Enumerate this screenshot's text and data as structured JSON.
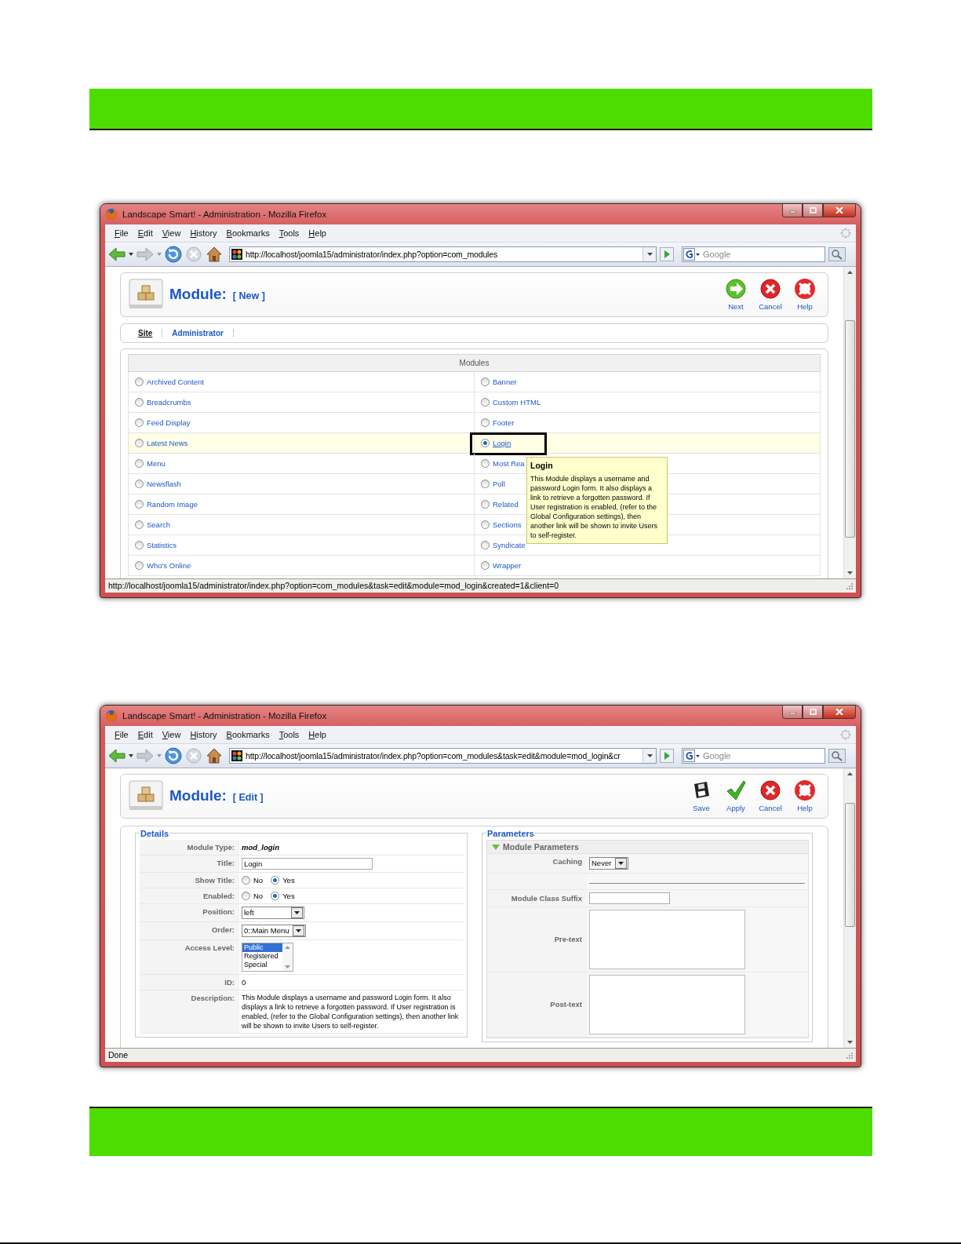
{
  "windows": [
    {
      "kind": "module_list",
      "title": "Landscape Smart! - Administration - Mozilla Firefox",
      "menu": [
        "File",
        "Edit",
        "View",
        "History",
        "Bookmarks",
        "Tools",
        "Help"
      ],
      "url": "http://localhost/joomla15/administrator/index.php?option=com_modules",
      "search": {
        "placeholder": "Google"
      },
      "page_title": "Module:",
      "page_subtitle": "[ New ]",
      "toolbar": [
        {
          "label": "Next",
          "kind": "next"
        },
        {
          "label": "Cancel",
          "kind": "cancel"
        },
        {
          "label": "Help",
          "kind": "help"
        }
      ],
      "submenu": [
        {
          "label": "Site",
          "selected": true
        },
        {
          "label": "Administrator",
          "selected": false
        }
      ],
      "modules": {
        "heading": "Modules",
        "rows": [
          {
            "hovered": false,
            "items": [
              {
                "label": "Archived Content",
                "selected": false
              },
              {
                "label": "Banner",
                "selected": false
              }
            ]
          },
          {
            "hovered": false,
            "items": [
              {
                "label": "Breadcrumbs",
                "selected": false
              },
              {
                "label": "Custom HTML",
                "selected": false
              }
            ]
          },
          {
            "hovered": false,
            "items": [
              {
                "label": "Feed Display",
                "selected": false
              },
              {
                "label": "Footer",
                "selected": false
              }
            ]
          },
          {
            "hovered": true,
            "items": [
              {
                "label": "Latest News",
                "selected": false
              },
              {
                "label": "Login",
                "selected": true,
                "outlined": true,
                "tooltip": {
                  "title": "Login",
                  "text": "This Module displays a username and password Login form. It also displays a link to retrieve a forgotten password. If User registration is enabled, (refer to the Global Configuration settings), then another link will be shown to invite Users to self-register."
                }
              }
            ]
          },
          {
            "hovered": false,
            "items": [
              {
                "label": "Menu",
                "selected": false
              },
              {
                "label": "Most Rea",
                "selected": false
              }
            ]
          },
          {
            "hovered": false,
            "items": [
              {
                "label": "Newsflash",
                "selected": false
              },
              {
                "label": "Poll",
                "selected": false
              }
            ]
          },
          {
            "hovered": false,
            "items": [
              {
                "label": "Random Image",
                "selected": false
              },
              {
                "label": "Related",
                "selected": false
              }
            ]
          },
          {
            "hovered": false,
            "items": [
              {
                "label": "Search",
                "selected": false
              },
              {
                "label": "Sections",
                "selected": false
              }
            ]
          },
          {
            "hovered": false,
            "items": [
              {
                "label": "Statistics",
                "selected": false
              },
              {
                "label": "Syndicate",
                "selected": false
              }
            ]
          },
          {
            "hovered": false,
            "items": [
              {
                "label": "Who's Online",
                "selected": false
              },
              {
                "label": "Wrapper",
                "selected": false
              }
            ]
          }
        ]
      },
      "status_bar": "http://localhost/joomla15/administrator/index.php?option=com_modules&task=edit&module=mod_login&created=1&client=0"
    },
    {
      "kind": "module_edit",
      "title": "Landscape Smart! - Administration - Mozilla Firefox",
      "menu": [
        "File",
        "Edit",
        "View",
        "History",
        "Bookmarks",
        "Tools",
        "Help"
      ],
      "url": "http://localhost/joomla15/administrator/index.php?option=com_modules&task=edit&module=mod_login&cr",
      "search": {
        "placeholder": "Google"
      },
      "page_title": "Module:",
      "page_subtitle": "[ Edit ]",
      "toolbar": [
        {
          "label": "Save",
          "kind": "save"
        },
        {
          "label": "Apply",
          "kind": "apply"
        },
        {
          "label": "Cancel",
          "kind": "cancel"
        },
        {
          "label": "Help",
          "kind": "help"
        }
      ],
      "details": {
        "legend": "Details",
        "rows": [
          {
            "label": "Module Type:",
            "kind": "code",
            "value": "mod_login"
          },
          {
            "label": "Title:",
            "kind": "input",
            "value": "Login"
          },
          {
            "label": "Show Title:",
            "kind": "radios",
            "options": [
              {
                "label": "No",
                "selected": false
              },
              {
                "label": "Yes",
                "selected": true
              }
            ]
          },
          {
            "label": "Enabled:",
            "kind": "radios",
            "options": [
              {
                "label": "No",
                "selected": false
              },
              {
                "label": "Yes",
                "selected": true
              }
            ]
          },
          {
            "label": "Position:",
            "kind": "select",
            "value": "left"
          },
          {
            "label": "Order:",
            "kind": "select",
            "value": "0::Main Menu"
          },
          {
            "label": "Access Level:",
            "kind": "listbox",
            "options": [
              {
                "label": "Public",
                "selected": true
              },
              {
                "label": "Registered",
                "selected": false
              },
              {
                "label": "Special",
                "selected": false
              }
            ]
          },
          {
            "label": "ID:",
            "kind": "value",
            "value": "0"
          },
          {
            "label": "Description:",
            "kind": "paragraph",
            "value": "This Module displays a username and password Login form. It also displays a link to retrieve a forgotten password. If User registration is enabled, (refer to the Global Configuration settings), then another link will be shown to invite Users to self-register."
          }
        ]
      },
      "parameters": {
        "legend": "Parameters",
        "panel_title": "Module Parameters",
        "expanded": true,
        "rows": [
          {
            "label": "Caching",
            "kind": "select",
            "value": "Never"
          },
          {
            "kind": "separator"
          },
          {
            "label": "Module Class Suffix",
            "kind": "input"
          },
          {
            "label": "Pre-text",
            "kind": "textarea"
          },
          {
            "label": "Post-text",
            "kind": "textarea"
          }
        ]
      },
      "status_bar": "Done"
    }
  ]
}
